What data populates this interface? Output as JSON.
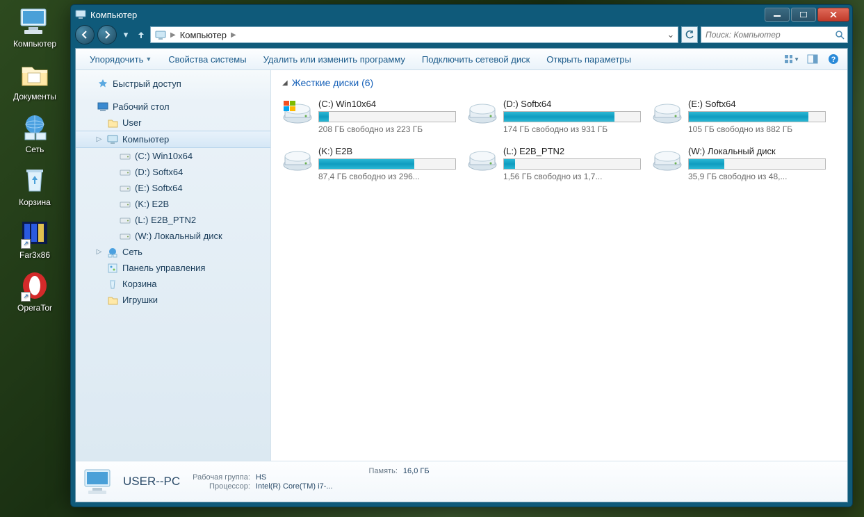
{
  "desktop": {
    "icons": [
      {
        "label": "Компьютер",
        "type": "computer"
      },
      {
        "label": "Документы",
        "type": "folder"
      },
      {
        "label": "Сеть",
        "type": "network"
      },
      {
        "label": "Корзина",
        "type": "recycle"
      },
      {
        "label": "Far3x86",
        "type": "far",
        "shortcut": true
      },
      {
        "label": "OperaTor",
        "type": "opera",
        "shortcut": true
      }
    ]
  },
  "window": {
    "title": "Компьютер",
    "address": {
      "root": "Компьютер"
    },
    "search_placeholder": "Поиск: Компьютер",
    "cmdbar": {
      "organize": "Упорядочить",
      "sysprops": "Свойства системы",
      "uninstall": "Удалить или изменить программу",
      "mapdrive": "Подключить сетевой диск",
      "settings": "Открыть параметры"
    }
  },
  "navpane": {
    "fav_label": "Быстрый доступ",
    "desktop_label": "Рабочий стол",
    "items": [
      {
        "label": "User",
        "icon": "folder"
      },
      {
        "label": "Компьютер",
        "icon": "computer",
        "selected": true
      },
      {
        "label": "(C:) Win10x64",
        "icon": "drive",
        "indent": 3
      },
      {
        "label": "(D:) Softx64",
        "icon": "drive",
        "indent": 3
      },
      {
        "label": "(E:) Softx64",
        "icon": "drive",
        "indent": 3
      },
      {
        "label": "(K:) E2B",
        "icon": "drive",
        "indent": 3
      },
      {
        "label": "(L:) E2B_PTN2",
        "icon": "drive",
        "indent": 3
      },
      {
        "label": "(W:) Локальный диск",
        "icon": "drive",
        "indent": 3
      },
      {
        "label": "Сеть",
        "icon": "network"
      },
      {
        "label": "Панель управления",
        "icon": "cpanel"
      },
      {
        "label": "Корзина",
        "icon": "recycle"
      },
      {
        "label": "Игрушки",
        "icon": "folder"
      }
    ]
  },
  "main": {
    "group_title": "Жесткие диски (6)",
    "drives": [
      {
        "name": "(C:) Win10x64",
        "free": "208 ГБ свободно из 223 ГБ",
        "pct": 7,
        "os": true
      },
      {
        "name": "(D:) Softx64",
        "free": "174 ГБ свободно из 931 ГБ",
        "pct": 81
      },
      {
        "name": "(E:) Softx64",
        "free": "105 ГБ свободно из 882 ГБ",
        "pct": 88
      },
      {
        "name": "(K:) E2B",
        "free": "87,4 ГБ свободно из 296...",
        "pct": 70
      },
      {
        "name": "(L:) E2B_PTN2",
        "free": "1,56 ГБ свободно из 1,7...",
        "pct": 8
      },
      {
        "name": "(W:) Локальный диск",
        "free": "35,9 ГБ свободно из 48,...",
        "pct": 26
      }
    ]
  },
  "details": {
    "pc_name": "USER--PC",
    "workgroup_k": "Рабочая группа:",
    "workgroup_v": "HS",
    "cpu_k": "Процессор:",
    "cpu_v": "Intel(R) Core(TM) i7-...",
    "mem_k": "Память:",
    "mem_v": "16,0 ГБ"
  }
}
